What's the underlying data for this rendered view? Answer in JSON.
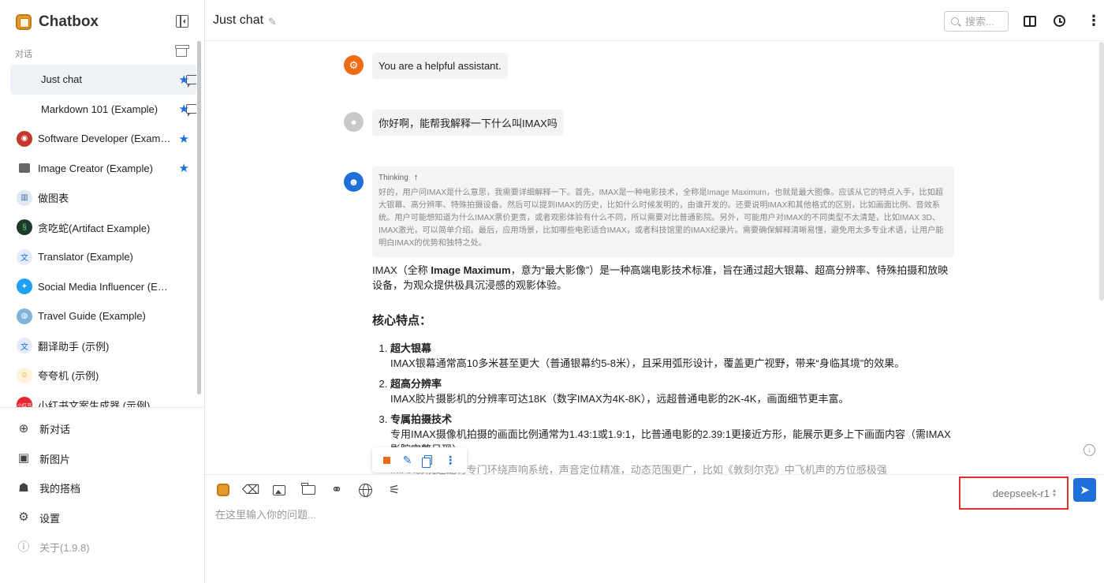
{
  "app": {
    "name": "Chatbox",
    "version_label": "关于(1.9.8)"
  },
  "sidebar": {
    "section_label": "对话",
    "conversations": [
      {
        "label": "Just chat",
        "icon": "chat-bubble-icon",
        "starred": true,
        "active": true
      },
      {
        "label": "Markdown 101 (Example)",
        "icon": "chat-bubble-icon",
        "starred": true
      },
      {
        "label": "Software Developer (Example)",
        "icon": "developer-avatar-icon",
        "starred": true
      },
      {
        "label": "Image Creator (Example)",
        "icon": "image-icon",
        "starred": true
      },
      {
        "label": "做图表",
        "icon": "chart-avatar-icon"
      },
      {
        "label": "贪吃蛇(Artifact Example)",
        "icon": "snake-avatar-icon"
      },
      {
        "label": "Translator (Example)",
        "icon": "translate-avatar-icon"
      },
      {
        "label": "Social Media Influencer (Example)",
        "icon": "twitter-avatar-icon"
      },
      {
        "label": "Travel Guide (Example)",
        "icon": "globe-avatar-icon"
      },
      {
        "label": "翻译助手 (示例)",
        "icon": "translate-avatar-icon"
      },
      {
        "label": "夸夸机 (示例)",
        "icon": "cheer-avatar-icon"
      },
      {
        "label": "小红书文案生成器 (示例)",
        "icon": "xiaohongshu-avatar-icon",
        "badge": "小红书"
      }
    ],
    "menu": [
      {
        "label": "新对话",
        "icon": "plus-circle-icon"
      },
      {
        "label": "新图片",
        "icon": "image-add-icon"
      },
      {
        "label": "我的搭档",
        "icon": "robot-icon"
      },
      {
        "label": "设置",
        "icon": "gear-icon"
      }
    ]
  },
  "header": {
    "title": "Just chat",
    "search_placeholder": "搜索..."
  },
  "messages": {
    "system": "You are a helpful assistant.",
    "user": "你好啊，能帮我解释一下什么叫IMAX吗",
    "thinking_label": "Thinking",
    "thinking_text": "好的，用户问IMAX是什么意思，我需要详细解释一下。首先，IMAX是一种电影技术，全称是Image Maximum，也就是最大图像。应该从它的特点入手，比如超大银幕、高分辨率、特殊拍摄设备。然后可以提到IMAX的历史，比如什么时候发明的，由谁开发的。还要说明IMAX和其他格式的区别，比如画面比例、音效系统。用户可能想知道为什么IMAX票价更贵，或者观影体验有什么不同，所以需要对比普通影院。另外，可能用户对IMAX的不同类型不太清楚，比如IMAX 3D、IMAX激光，可以简单介绍。最后，应用场景，比如哪些电影适合IMAX，或者科技馆里的IMAX纪录片。需要确保解释清晰易懂，避免用太多专业术语，让用户能明白IMAX的优势和独特之处。",
    "answer": {
      "lead_pre": "IMAX（全称 ",
      "lead_bold": "Image Maximum",
      "lead_post": "，意为“最大影像”）是一种高端电影技术标准，旨在通过超大银幕、超高分辨率、特殊拍摄和放映设备，为观众提供极具沉浸感的观影体验。",
      "section_title": "核心特点：",
      "points": [
        {
          "title": "超大银幕",
          "text": "IMAX银幕通常高10多米甚至更大（普通银幕约5-8米），且采用弧形设计，覆盖更广视野，带来“身临其境”的效果。"
        },
        {
          "title": "超高分辨率",
          "text": "IMAX胶片摄影机的分辨率可达18K（数字IMAX为4K-8K），远超普通电影的2K-4K，画面细节更丰富。"
        },
        {
          "title": "专属拍摄技术",
          "text": "专用IMAX摄像机拍摄的画面比例通常为1.43:1或1.9:1，比普通电影的2.39:1更接近方形，能展示更多上下画面内容（需IMAX影院完整呈现）。"
        }
      ],
      "truncated_line": "IMAX影院还配有专门环绕声响系统，声音定位精准，动态范围更广，比如《敦刻尔克》中飞机声的方位感极强"
    }
  },
  "composer": {
    "model": "deepseek-r1",
    "placeholder": "在这里输入你的问题...",
    "highlight_color": "#e03131"
  },
  "colors": {
    "accent": "#1e6fd9",
    "system_avatar": "#ef6c16"
  }
}
